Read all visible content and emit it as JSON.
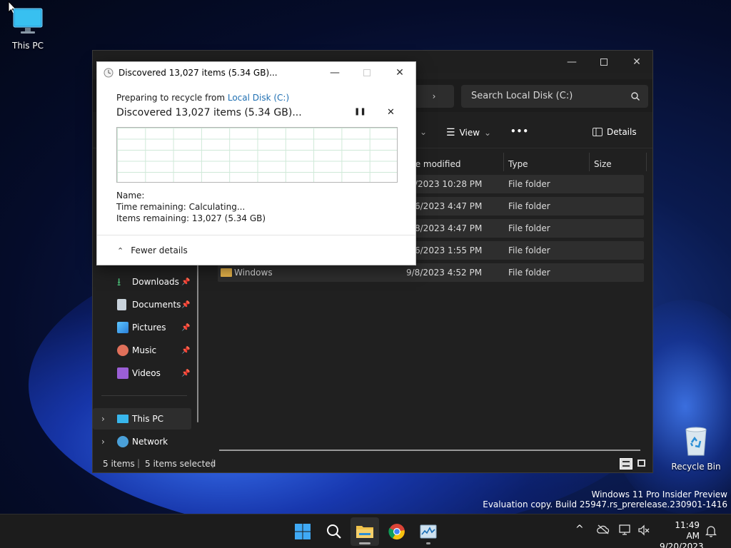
{
  "desktop": {
    "this_pc_label": "This PC",
    "recycle_bin_label": "Recycle Bin",
    "watermark_line1": "Windows 11 Pro Insider Preview",
    "watermark_line2": "Evaluation copy. Build 25947.rs_prerelease.230901-1416"
  },
  "explorer": {
    "search_placeholder": "Search Local Disk (C:)",
    "toolbar": {
      "view_label": "View",
      "more_label": "•••",
      "details_label": "Details"
    },
    "columns": {
      "date_modified": "te modified",
      "type": "Type",
      "size": "Size"
    },
    "rows": [
      {
        "name": "",
        "date": "/2023 10:28 PM",
        "type": "File folder"
      },
      {
        "name": "",
        "date": "6/2023 4:47 PM",
        "type": "File folder"
      },
      {
        "name": "",
        "date": "8/2023 4:47 PM",
        "type": "File folder"
      },
      {
        "name": "",
        "date": "6/2023 1:55 PM",
        "type": "File folder"
      },
      {
        "name": "Windows",
        "date": "9/8/2023 4:52 PM",
        "type": "File folder"
      }
    ],
    "nav": {
      "downloads": "Downloads",
      "documents": "Documents",
      "pictures": "Pictures",
      "music": "Music",
      "videos": "Videos",
      "this_pc": "This PC",
      "network": "Network"
    },
    "status": {
      "items": "5 items",
      "selected": "5 items selected"
    }
  },
  "dialog": {
    "title": "Discovered 13,027 items (5.34 GB)...",
    "preparing_prefix": "Preparing to recycle from ",
    "preparing_link": "Local Disk (C:)",
    "heading": "Discovered 13,027 items (5.34 GB)...",
    "name_label": "Name:",
    "time_remaining": "Time remaining:  Calculating...",
    "items_remaining": "Items remaining:  13,027 (5.34 GB)",
    "fewer_details": "Fewer details"
  },
  "taskbar": {
    "time": "11:49 AM",
    "date": "9/20/2023"
  },
  "colors": {
    "accent": "#0067c0",
    "folder": "#e8b44a",
    "link": "#1f6fb2"
  }
}
